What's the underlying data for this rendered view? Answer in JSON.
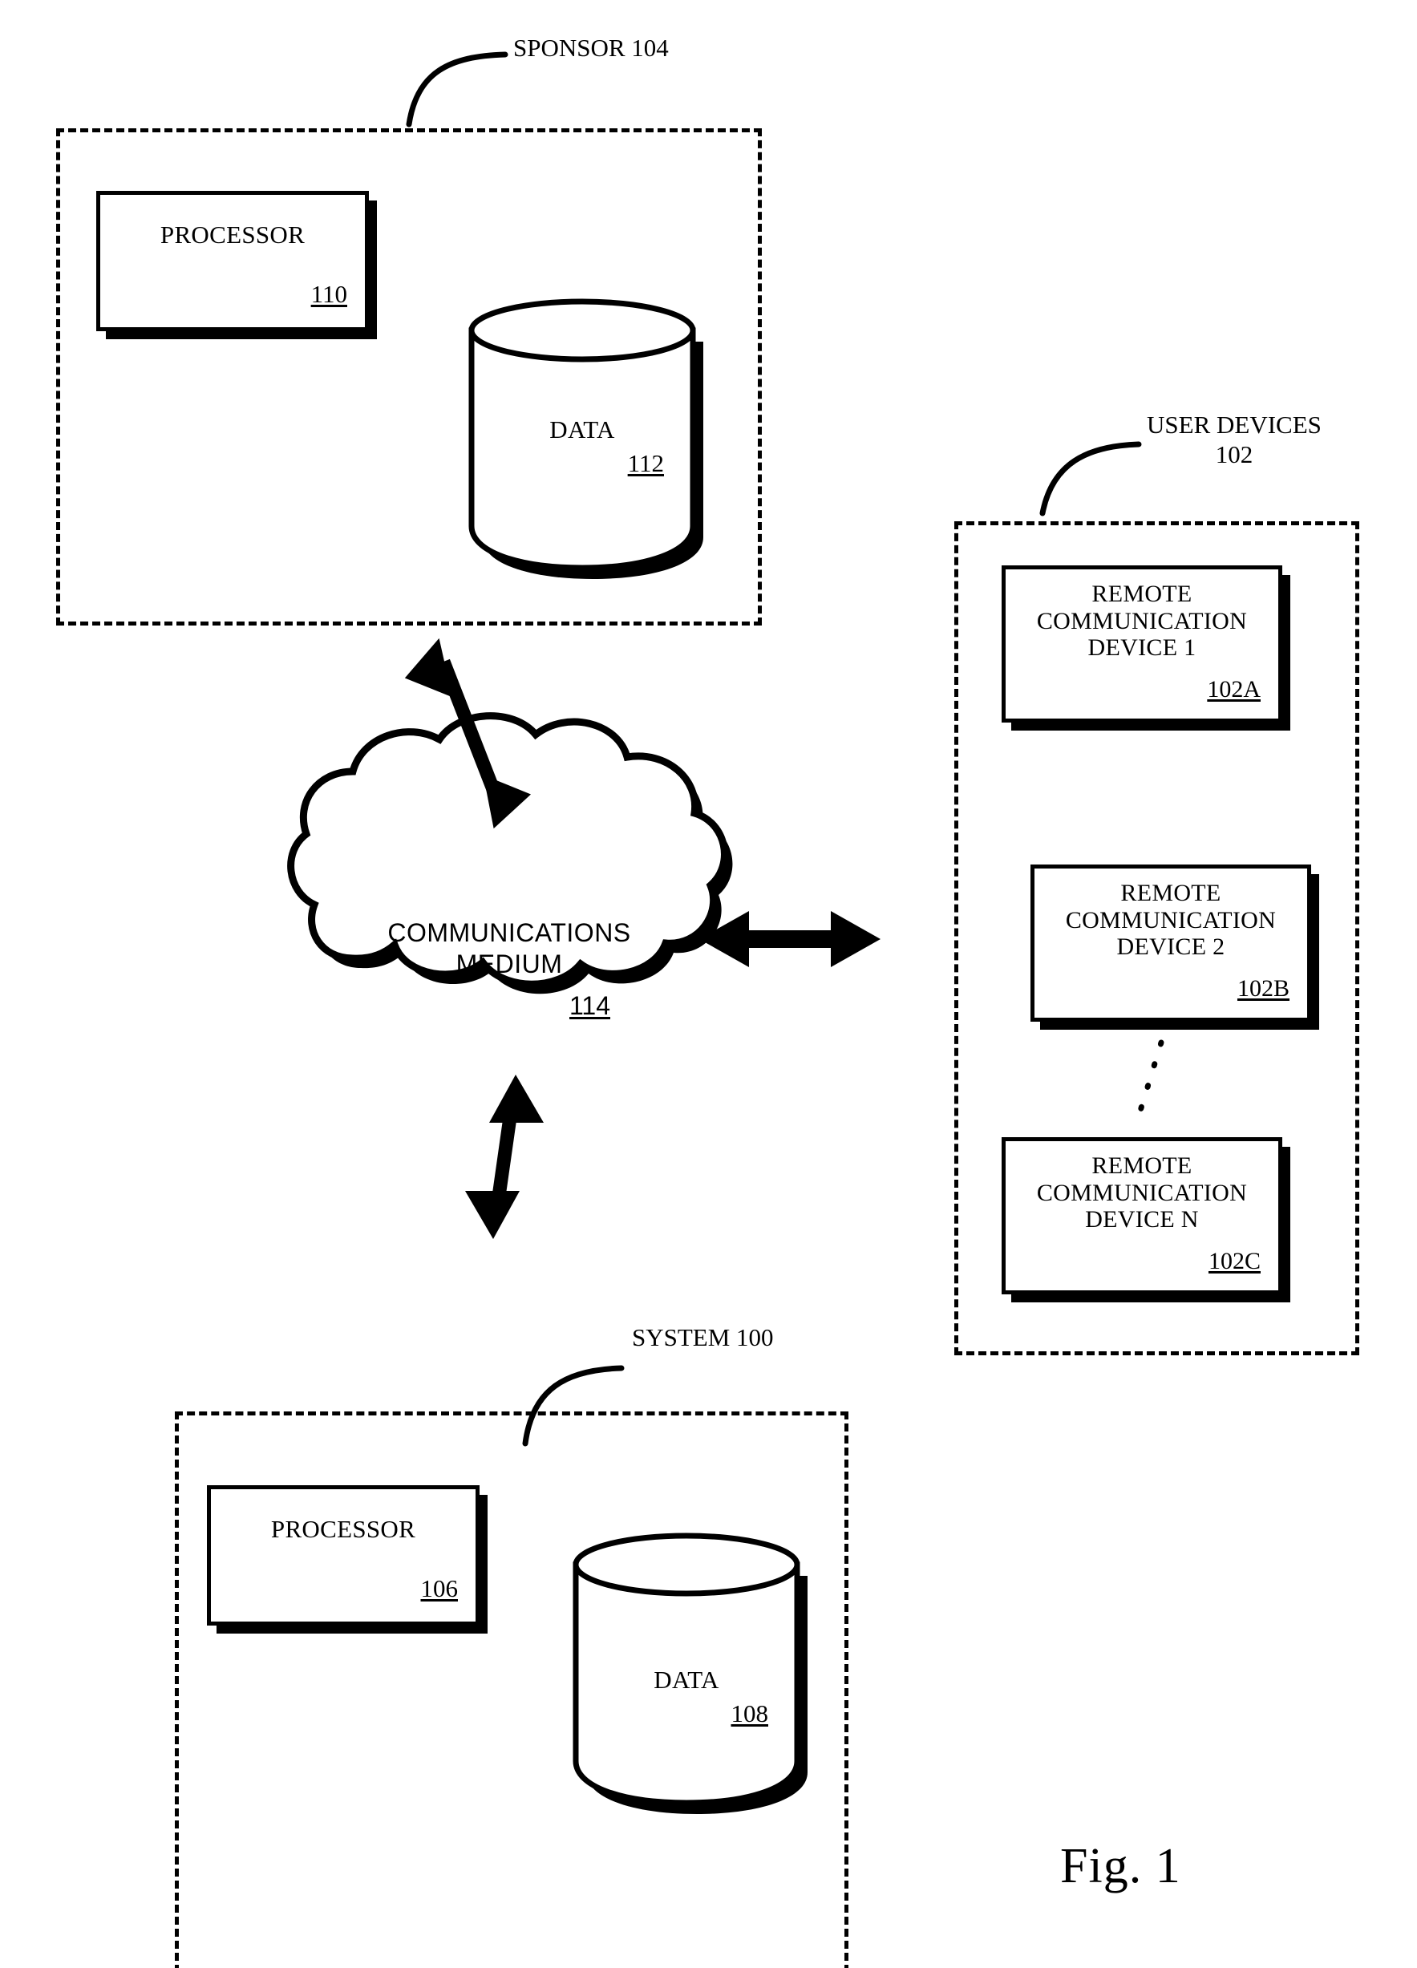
{
  "figure": {
    "caption": "Fig. 1",
    "type": "patent-block-diagram"
  },
  "groups": {
    "sponsor": {
      "label": "SPONSOR 104",
      "ref": "104"
    },
    "user_devices": {
      "label_line1": "USER DEVICES",
      "label_line2": "102",
      "ref": "102"
    },
    "system": {
      "label": "SYSTEM 100",
      "ref": "100"
    }
  },
  "blocks": {
    "sponsor_processor": {
      "title": "PROCESSOR",
      "refnum": "110"
    },
    "sponsor_data": {
      "title": "DATA",
      "refnum": "112"
    },
    "system_processor": {
      "title": "PROCESSOR",
      "refnum": "106"
    },
    "system_data": {
      "title": "DATA",
      "refnum": "108"
    },
    "cloud": {
      "line1": "COMMUNICATIONS",
      "line2": "MEDIUM",
      "refnum": "114"
    },
    "device_1": {
      "line1": "REMOTE",
      "line2": "COMMUNICATION",
      "line3": "DEVICE 1",
      "refnum": "102A"
    },
    "device_2": {
      "line1": "REMOTE",
      "line2": "COMMUNICATION",
      "line3": "DEVICE 2",
      "refnum": "102B"
    },
    "device_n": {
      "line1": "REMOTE",
      "line2": "COMMUNICATION",
      "line3": "DEVICE N",
      "refnum": "102C"
    }
  },
  "connectors": {
    "sponsor_to_cloud": "double-headed-arrow",
    "cloud_to_user_devices": "double-headed-arrow",
    "cloud_to_system": "double-headed-arrow",
    "device2_to_deviceN": "dotted-ellipsis-line"
  },
  "colors": {
    "ink": "#000000",
    "paper": "#ffffff"
  }
}
